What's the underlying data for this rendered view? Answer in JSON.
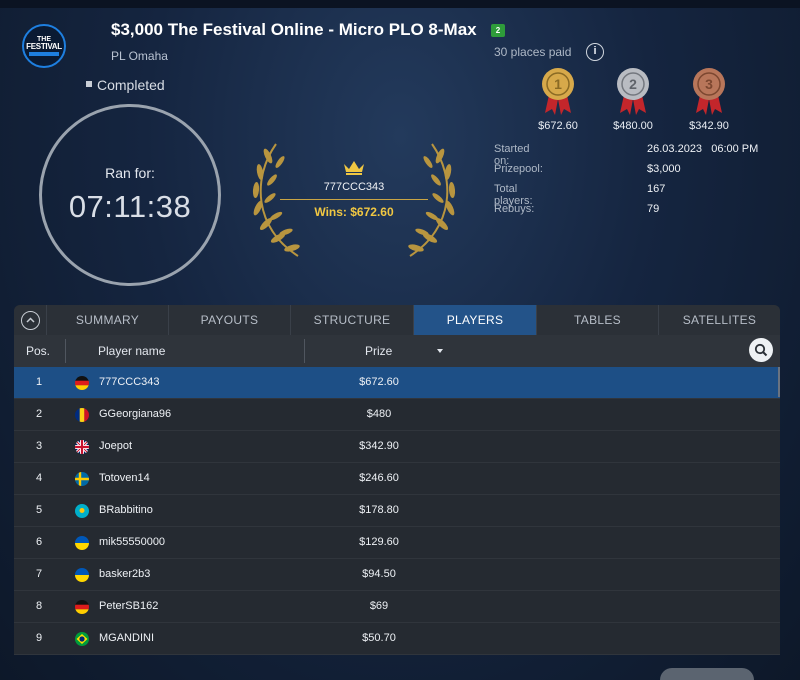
{
  "header": {
    "logo_line1": "THE",
    "logo_line2": "FESTIVAL",
    "title": "$3,000 The Festival Online - Micro PLO 8-Max",
    "title_badge": "2",
    "subtitle": "PL Omaha",
    "status": "Completed"
  },
  "timer": {
    "label": "Ran for:",
    "value": "07:11:38"
  },
  "winner": {
    "name": "777CCC343",
    "wins": "Wins: $672.60"
  },
  "payouts": {
    "places_paid": "30 places paid",
    "medals": [
      {
        "rank": "1",
        "amount": "$672.60",
        "color": "#d7a94a"
      },
      {
        "rank": "2",
        "amount": "$480.00",
        "color": "#b9bcc2"
      },
      {
        "rank": "3",
        "amount": "$342.90",
        "color": "#b8765a"
      }
    ]
  },
  "info": {
    "started_label": "Started on:",
    "started_value": "26.03.2023   06:00 PM",
    "prizepool_label": "Prizepool:",
    "prizepool_value": "$3,000",
    "players_label": "Total players:",
    "players_value": "167",
    "rebuys_label": "Rebuys:",
    "rebuys_value": "79"
  },
  "tabs": [
    "SUMMARY",
    "PAYOUTS",
    "STRUCTURE",
    "PLAYERS",
    "TABLES",
    "SATELLITES"
  ],
  "active_tab": "PLAYERS",
  "table": {
    "col_pos": "Pos.",
    "col_name": "Player name",
    "col_prize": "Prize",
    "rows": [
      {
        "pos": "1",
        "flag": "de",
        "name": "777CCC343",
        "prize": "$672.60"
      },
      {
        "pos": "2",
        "flag": "ro",
        "name": "GGeorgiana96",
        "prize": "$480"
      },
      {
        "pos": "3",
        "flag": "gb",
        "name": "Joepot",
        "prize": "$342.90"
      },
      {
        "pos": "4",
        "flag": "se",
        "name": "Totoven14",
        "prize": "$246.60"
      },
      {
        "pos": "5",
        "flag": "kz",
        "name": "BRabbitino",
        "prize": "$178.80"
      },
      {
        "pos": "6",
        "flag": "ua",
        "name": "mik55550000",
        "prize": "$129.60"
      },
      {
        "pos": "7",
        "flag": "ua",
        "name": "basker2b3",
        "prize": "$94.50"
      },
      {
        "pos": "8",
        "flag": "de",
        "name": "PeterSB162",
        "prize": "$69"
      },
      {
        "pos": "9",
        "flag": "br",
        "name": "MGANDINI",
        "prize": "$50.70"
      }
    ]
  }
}
